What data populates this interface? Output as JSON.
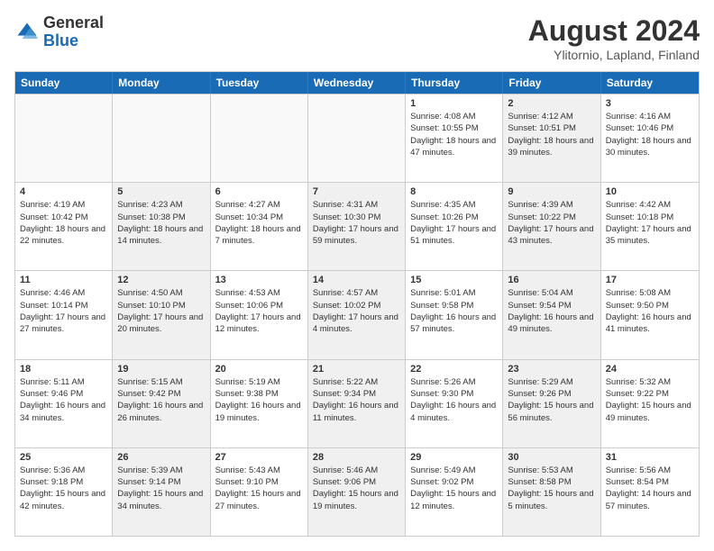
{
  "header": {
    "logo_general": "General",
    "logo_blue": "Blue",
    "title": "August 2024",
    "location": "Ylitornio, Lapland, Finland"
  },
  "days_of_week": [
    "Sunday",
    "Monday",
    "Tuesday",
    "Wednesday",
    "Thursday",
    "Friday",
    "Saturday"
  ],
  "weeks": [
    [
      {
        "num": "",
        "info": "",
        "empty": true
      },
      {
        "num": "",
        "info": "",
        "empty": true
      },
      {
        "num": "",
        "info": "",
        "empty": true
      },
      {
        "num": "",
        "info": "",
        "empty": true
      },
      {
        "num": "1",
        "info": "Sunrise: 4:08 AM\nSunset: 10:55 PM\nDaylight: 18 hours and 47 minutes.",
        "empty": false,
        "shaded": false
      },
      {
        "num": "2",
        "info": "Sunrise: 4:12 AM\nSunset: 10:51 PM\nDaylight: 18 hours and 39 minutes.",
        "empty": false,
        "shaded": true
      },
      {
        "num": "3",
        "info": "Sunrise: 4:16 AM\nSunset: 10:46 PM\nDaylight: 18 hours and 30 minutes.",
        "empty": false,
        "shaded": false
      }
    ],
    [
      {
        "num": "4",
        "info": "Sunrise: 4:19 AM\nSunset: 10:42 PM\nDaylight: 18 hours and 22 minutes.",
        "empty": false,
        "shaded": false
      },
      {
        "num": "5",
        "info": "Sunrise: 4:23 AM\nSunset: 10:38 PM\nDaylight: 18 hours and 14 minutes.",
        "empty": false,
        "shaded": true
      },
      {
        "num": "6",
        "info": "Sunrise: 4:27 AM\nSunset: 10:34 PM\nDaylight: 18 hours and 7 minutes.",
        "empty": false,
        "shaded": false
      },
      {
        "num": "7",
        "info": "Sunrise: 4:31 AM\nSunset: 10:30 PM\nDaylight: 17 hours and 59 minutes.",
        "empty": false,
        "shaded": true
      },
      {
        "num": "8",
        "info": "Sunrise: 4:35 AM\nSunset: 10:26 PM\nDaylight: 17 hours and 51 minutes.",
        "empty": false,
        "shaded": false
      },
      {
        "num": "9",
        "info": "Sunrise: 4:39 AM\nSunset: 10:22 PM\nDaylight: 17 hours and 43 minutes.",
        "empty": false,
        "shaded": true
      },
      {
        "num": "10",
        "info": "Sunrise: 4:42 AM\nSunset: 10:18 PM\nDaylight: 17 hours and 35 minutes.",
        "empty": false,
        "shaded": false
      }
    ],
    [
      {
        "num": "11",
        "info": "Sunrise: 4:46 AM\nSunset: 10:14 PM\nDaylight: 17 hours and 27 minutes.",
        "empty": false,
        "shaded": false
      },
      {
        "num": "12",
        "info": "Sunrise: 4:50 AM\nSunset: 10:10 PM\nDaylight: 17 hours and 20 minutes.",
        "empty": false,
        "shaded": true
      },
      {
        "num": "13",
        "info": "Sunrise: 4:53 AM\nSunset: 10:06 PM\nDaylight: 17 hours and 12 minutes.",
        "empty": false,
        "shaded": false
      },
      {
        "num": "14",
        "info": "Sunrise: 4:57 AM\nSunset: 10:02 PM\nDaylight: 17 hours and 4 minutes.",
        "empty": false,
        "shaded": true
      },
      {
        "num": "15",
        "info": "Sunrise: 5:01 AM\nSunset: 9:58 PM\nDaylight: 16 hours and 57 minutes.",
        "empty": false,
        "shaded": false
      },
      {
        "num": "16",
        "info": "Sunrise: 5:04 AM\nSunset: 9:54 PM\nDaylight: 16 hours and 49 minutes.",
        "empty": false,
        "shaded": true
      },
      {
        "num": "17",
        "info": "Sunrise: 5:08 AM\nSunset: 9:50 PM\nDaylight: 16 hours and 41 minutes.",
        "empty": false,
        "shaded": false
      }
    ],
    [
      {
        "num": "18",
        "info": "Sunrise: 5:11 AM\nSunset: 9:46 PM\nDaylight: 16 hours and 34 minutes.",
        "empty": false,
        "shaded": false
      },
      {
        "num": "19",
        "info": "Sunrise: 5:15 AM\nSunset: 9:42 PM\nDaylight: 16 hours and 26 minutes.",
        "empty": false,
        "shaded": true
      },
      {
        "num": "20",
        "info": "Sunrise: 5:19 AM\nSunset: 9:38 PM\nDaylight: 16 hours and 19 minutes.",
        "empty": false,
        "shaded": false
      },
      {
        "num": "21",
        "info": "Sunrise: 5:22 AM\nSunset: 9:34 PM\nDaylight: 16 hours and 11 minutes.",
        "empty": false,
        "shaded": true
      },
      {
        "num": "22",
        "info": "Sunrise: 5:26 AM\nSunset: 9:30 PM\nDaylight: 16 hours and 4 minutes.",
        "empty": false,
        "shaded": false
      },
      {
        "num": "23",
        "info": "Sunrise: 5:29 AM\nSunset: 9:26 PM\nDaylight: 15 hours and 56 minutes.",
        "empty": false,
        "shaded": true
      },
      {
        "num": "24",
        "info": "Sunrise: 5:32 AM\nSunset: 9:22 PM\nDaylight: 15 hours and 49 minutes.",
        "empty": false,
        "shaded": false
      }
    ],
    [
      {
        "num": "25",
        "info": "Sunrise: 5:36 AM\nSunset: 9:18 PM\nDaylight: 15 hours and 42 minutes.",
        "empty": false,
        "shaded": false
      },
      {
        "num": "26",
        "info": "Sunrise: 5:39 AM\nSunset: 9:14 PM\nDaylight: 15 hours and 34 minutes.",
        "empty": false,
        "shaded": true
      },
      {
        "num": "27",
        "info": "Sunrise: 5:43 AM\nSunset: 9:10 PM\nDaylight: 15 hours and 27 minutes.",
        "empty": false,
        "shaded": false
      },
      {
        "num": "28",
        "info": "Sunrise: 5:46 AM\nSunset: 9:06 PM\nDaylight: 15 hours and 19 minutes.",
        "empty": false,
        "shaded": true
      },
      {
        "num": "29",
        "info": "Sunrise: 5:49 AM\nSunset: 9:02 PM\nDaylight: 15 hours and 12 minutes.",
        "empty": false,
        "shaded": false
      },
      {
        "num": "30",
        "info": "Sunrise: 5:53 AM\nSunset: 8:58 PM\nDaylight: 15 hours and 5 minutes.",
        "empty": false,
        "shaded": true
      },
      {
        "num": "31",
        "info": "Sunrise: 5:56 AM\nSunset: 8:54 PM\nDaylight: 14 hours and 57 minutes.",
        "empty": false,
        "shaded": false
      }
    ]
  ]
}
